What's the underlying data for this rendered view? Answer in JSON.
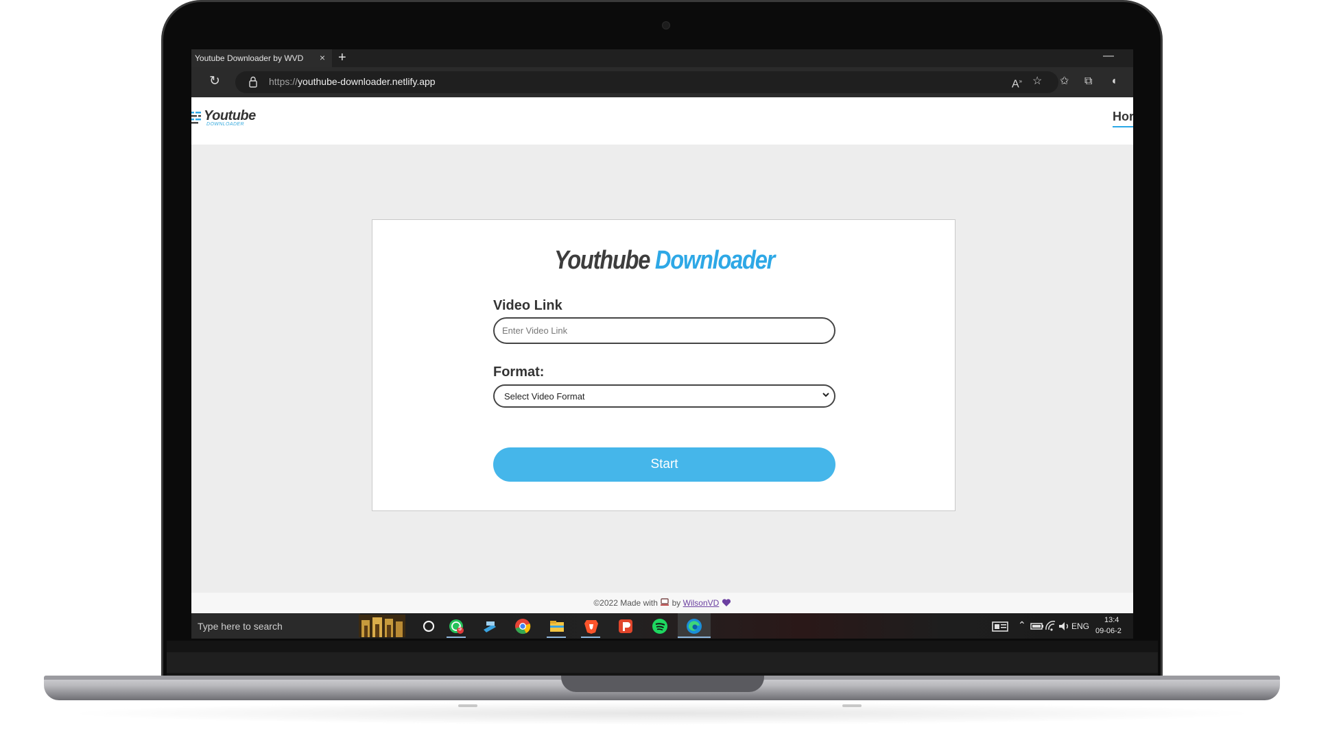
{
  "browser": {
    "tab_title": "Youtube Downloader by WVD",
    "tab_close": "×",
    "new_tab": "+",
    "window_minimize": "—",
    "url_scheme": "https://",
    "url_host": "youthube-downloader.netlify.app"
  },
  "site": {
    "logo_main": "Youtube",
    "logo_sub": "DOWNLOADER",
    "nav_home": "Hor"
  },
  "card": {
    "title_part1": "Youthube",
    "title_part2": "Downloader",
    "video_link_label": "Video Link",
    "video_link_placeholder": "Enter Video Link",
    "format_label": "Format:",
    "format_selected": "Select Video Format",
    "start_label": "Start"
  },
  "footer": {
    "prefix": "©2022 Made with",
    "by": "by",
    "author": "WilsonVD"
  },
  "taskbar": {
    "search_placeholder": "Type here to search",
    "whatsapp_badge": "5",
    "language": "ENG",
    "time": "13:4",
    "date": "09-06-2"
  },
  "colors": {
    "accent": "#2ea8e6",
    "button": "#45b6ea",
    "link": "#6b3fa0"
  }
}
